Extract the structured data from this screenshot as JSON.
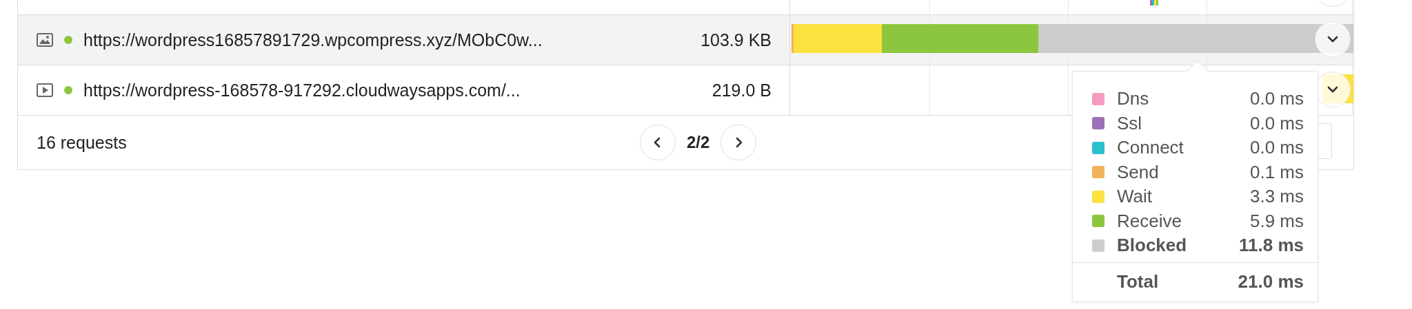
{
  "requests_table": {
    "rows": [
      {
        "kind": "image",
        "selected": true,
        "status": {
          "color": "#8cc63f"
        },
        "url": "https://wordpress16857891729.wpcompress.xyz/MObC0w...",
        "size": "103.9 KB",
        "bar": [
          {
            "kind": "segment",
            "color": "#f0b35a"
          },
          {
            "kind": "segment",
            "color": "#fde13f"
          },
          {
            "kind": "segment",
            "color": "#8cc63f"
          },
          {
            "kind": "segment",
            "color": "#cccccc"
          }
        ]
      },
      {
        "kind": "video",
        "selected": false,
        "status": {
          "color": "#8cc63f"
        },
        "url": "https://wordpress-168578-917292.cloudwaysapps.com/...",
        "size": "219.0 B",
        "bar": [
          {
            "kind": "empty"
          },
          {
            "kind": "segment",
            "color": "#fde13f"
          }
        ]
      }
    ],
    "footer": {
      "count": "16 requests",
      "page": "2/2"
    }
  },
  "timing_tooltip": {
    "phases": [
      {
        "label": "Dns",
        "value": "0.0 ms",
        "color": "#f59ac0",
        "emphasized": false
      },
      {
        "label": "Ssl",
        "value": "0.0 ms",
        "color": "#9b72b8",
        "emphasized": false
      },
      {
        "label": "Connect",
        "value": "0.0 ms",
        "color": "#2bc0cd",
        "emphasized": false
      },
      {
        "label": "Send",
        "value": "0.1 ms",
        "color": "#f0b35a",
        "emphasized": false
      },
      {
        "label": "Wait",
        "value": "3.3 ms",
        "color": "#fde13f",
        "emphasized": false
      },
      {
        "label": "Receive",
        "value": "5.9 ms",
        "color": "#8cc63f",
        "emphasized": false
      },
      {
        "label": "Blocked",
        "value": "11.8 ms",
        "color": "#cccccc",
        "emphasized": true
      }
    ],
    "total": {
      "label": "Total",
      "value": "21.0 ms"
    }
  }
}
